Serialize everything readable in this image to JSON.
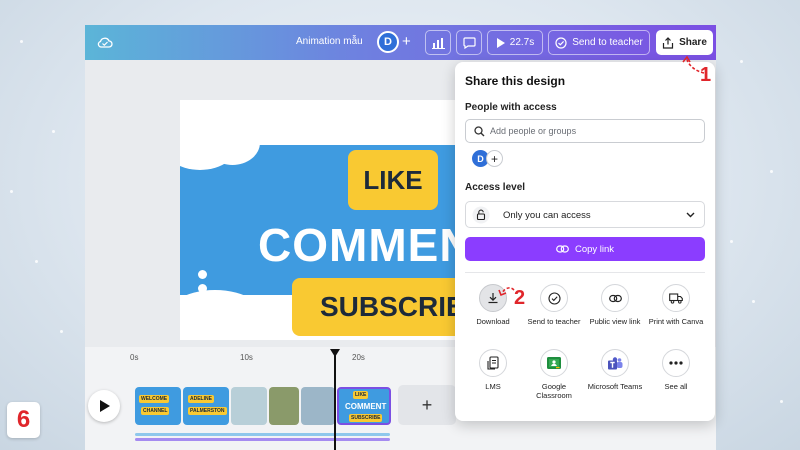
{
  "app": {
    "doc_title": "Animation mẫu",
    "avatar_initial": "D",
    "duration": "22.7s",
    "send_to_teacher": "Send to teacher",
    "share": "Share"
  },
  "design": {
    "like": "LIKE",
    "comment": "COMMENT",
    "subscribe": "SUBSCRIBE"
  },
  "timeline": {
    "ticks": [
      "0s",
      "10s",
      "20s"
    ],
    "thumb_labels": [
      "WELCOME",
      "CHANNEL",
      "ADELINE",
      "PALMERSTON",
      "LIKE",
      "COMMENT",
      "SUBSCRIBE"
    ]
  },
  "share_panel": {
    "title": "Share this design",
    "people_label": "People with access",
    "search_placeholder": "Add people or groups",
    "avatar_initial": "D",
    "access_label": "Access level",
    "access_value": "Only you can access",
    "copy_link": "Copy link",
    "options": [
      {
        "label": "Download",
        "icon": "download-icon"
      },
      {
        "label": "Send to teacher",
        "icon": "check-circle-icon"
      },
      {
        "label": "Public view link",
        "icon": "link-icon"
      },
      {
        "label": "Print with Canva",
        "icon": "truck-icon"
      },
      {
        "label": "LMS",
        "icon": "document-export-icon"
      },
      {
        "label": "Google Classroom",
        "icon": "google-classroom-icon"
      },
      {
        "label": "Microsoft Teams",
        "icon": "microsoft-teams-icon"
      },
      {
        "label": "See all",
        "icon": "more-icon"
      }
    ]
  },
  "annotations": {
    "step1": "1",
    "step2": "2",
    "step_badge": "6"
  },
  "colors": {
    "accent_purple": "#8b3dff",
    "annotation_red": "#e0262b",
    "design_blue": "#3f9be0",
    "pill_yellow": "#f9c932"
  }
}
